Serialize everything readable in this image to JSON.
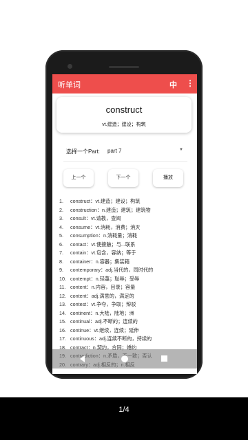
{
  "appbar": {
    "title": "听单词",
    "lang": "中",
    "more": "⋮"
  },
  "card": {
    "word": "construct",
    "definition": "vt.建造；建设；构筑"
  },
  "part_select": {
    "label": "选择一个Part:",
    "value": "part 7"
  },
  "buttons": {
    "prev": "上一个",
    "next": "下一个",
    "play": "播放"
  },
  "words": [
    {
      "n": "1.",
      "text": "construct：vt.建造；建设；构筑"
    },
    {
      "n": "2.",
      "text": "construction：n.建造；建筑；建筑物"
    },
    {
      "n": "3.",
      "text": "consult：vt.请教，查阅"
    },
    {
      "n": "4.",
      "text": "consume：vt.消耗，消费；消灭"
    },
    {
      "n": "5.",
      "text": "consumption：n.消耗量；消耗"
    },
    {
      "n": "6.",
      "text": "contact：vt.使接触；与...联系"
    },
    {
      "n": "7.",
      "text": "contain：vt.包含，容纳；等于"
    },
    {
      "n": "8.",
      "text": "container：n.容器；集装箱"
    },
    {
      "n": "9.",
      "text": "contemporary：adj.当代的，同时代的"
    },
    {
      "n": "10.",
      "text": "contempt：n.轻蔑；耻辱；受辱"
    },
    {
      "n": "11.",
      "text": "content：n.内容，目录；容量"
    },
    {
      "n": "12.",
      "text": "content：adj.满意的，满足的"
    },
    {
      "n": "13.",
      "text": "contest：vt.争夺，争取；辩驳"
    },
    {
      "n": "14.",
      "text": "continent：n.大陆，陆地；洲"
    },
    {
      "n": "15.",
      "text": "continual：adj.不断的；连续的"
    },
    {
      "n": "16.",
      "text": "continue：vt.继续，连续；延伸"
    },
    {
      "n": "17.",
      "text": "continuous：adj.连续不断的，持续的"
    },
    {
      "n": "18.",
      "text": "contract：n.契约，合同；婚约"
    },
    {
      "n": "19.",
      "text": "contradiction：n.矛盾，不一致；否认"
    },
    {
      "n": "20.",
      "text": "contrary：adj.相反的；n.相反"
    }
  ],
  "pager": "1/4"
}
